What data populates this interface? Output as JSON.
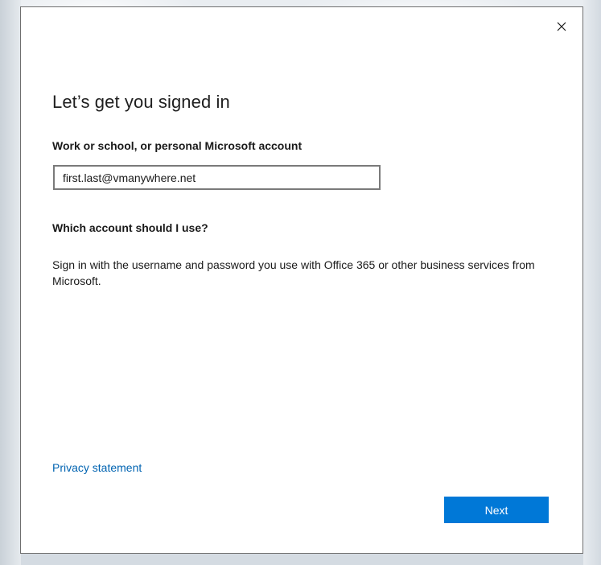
{
  "dialog": {
    "title": "Let’s get you signed in",
    "close_icon": "close-icon",
    "account_field": {
      "label": "Work or school, or personal Microsoft account",
      "value": "first.last@vmanywhere.net"
    },
    "help": {
      "heading": "Which account should I use?",
      "text": "Sign in with the username and password you use with Office 365 or other business services from Microsoft."
    },
    "privacy_link": "Privacy statement",
    "next_button": "Next"
  },
  "colors": {
    "accent": "#0078d7",
    "link": "#0063b1",
    "dialog_background": "#ffffff",
    "input_border": "#7a7a7a"
  }
}
